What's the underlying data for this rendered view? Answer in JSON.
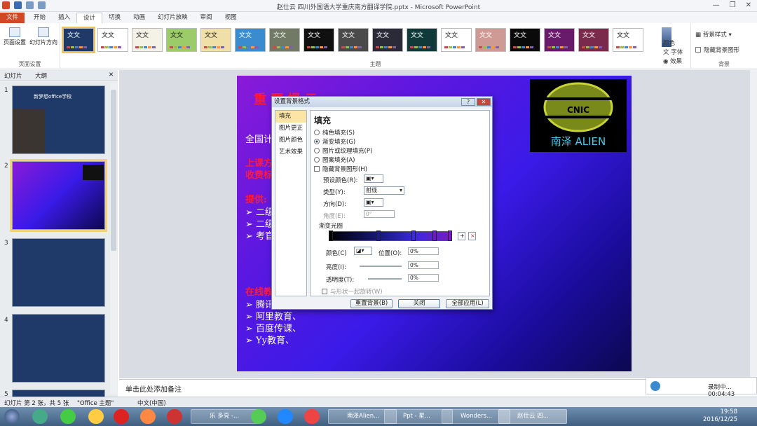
{
  "window": {
    "title": "赵仕云 四川外国语大学重庆南方翻译学院.pptx - Microsoft PowerPoint",
    "min": "—",
    "max": "❐",
    "close": "✕"
  },
  "tabs": [
    "文件",
    "开始",
    "插入",
    "设计",
    "切换",
    "动画",
    "幻灯片放映",
    "审阅",
    "视图"
  ],
  "ribbon": {
    "page_setup": "页面设置",
    "slide_orient": "幻灯片方向",
    "group_page": "页面设置",
    "group_theme": "主题",
    "theme_label": "文文",
    "colors": "颜色",
    "fonts": "字体",
    "effects": "效果",
    "bg_styles": "背景样式",
    "hide_bg": "隐藏背景图形",
    "group_bg": "背景"
  },
  "themes": [
    {
      "bg": "#1f3a68",
      "fg": "#fff",
      "sel": true
    },
    {
      "bg": "#ffffff",
      "fg": "#222"
    },
    {
      "bg": "#f4f1e6",
      "fg": "#222"
    },
    {
      "bg": "#9ccb6a",
      "fg": "#222"
    },
    {
      "bg": "#f1dfa8",
      "fg": "#222"
    },
    {
      "bg": "#3a8ccf",
      "fg": "#fff"
    },
    {
      "bg": "#707a64",
      "fg": "#fff"
    },
    {
      "bg": "#101010",
      "fg": "#fff"
    },
    {
      "bg": "#4a4a4a",
      "fg": "#fff"
    },
    {
      "bg": "#2a2a38",
      "fg": "#fff"
    },
    {
      "bg": "#103a3a",
      "fg": "#fff"
    },
    {
      "bg": "#ffffff",
      "fg": "#222"
    },
    {
      "bg": "#cf9a94",
      "fg": "#fff"
    },
    {
      "bg": "#0a0a0a",
      "fg": "#fff"
    },
    {
      "bg": "#6a1a6a",
      "fg": "#fff"
    },
    {
      "bg": "#7a2a4a",
      "fg": "#fff"
    },
    {
      "bg": "#ffffff",
      "fg": "#222"
    }
  ],
  "pane": {
    "tab_slides": "幻灯片",
    "tab_outline": "大纲",
    "close": "✕"
  },
  "thumbs": [
    {
      "num": "1",
      "title": "新梦想office学校"
    },
    {
      "num": "2",
      "title": ""
    },
    {
      "num": "3",
      "title": ""
    },
    {
      "num": "4",
      "title": ""
    },
    {
      "num": "5",
      "title": ""
    }
  ],
  "slide": {
    "heading": "重 要 提 示",
    "line1": "全国计",
    "line2": "上课方",
    "line3": "收费标",
    "tip": "提供:",
    "b1": "➢  二级",
    "b2": "➢  二级",
    "b3": "➢  考官",
    "online": "在线教",
    "o1": "➢  腾讯",
    "o2": "➢  阿里教育、",
    "o3": "➢  百度传课、",
    "o4": "➢  Yy教育、",
    "logo_text": "CNIC",
    "logo_sub": "南泽 ALIEN"
  },
  "dialog": {
    "title": "设置背景格式",
    "help": "?",
    "close": "✕",
    "cats": [
      "填充",
      "图片更正",
      "图片颜色",
      "艺术效果"
    ],
    "heading": "填充",
    "opts": [
      "纯色填充(S)",
      "渐变填充(G)",
      "图片或纹理填充(P)",
      "图案填充(A)"
    ],
    "hide_bg": "隐藏背景图形(H)",
    "preset": "预设颜色(R):",
    "type": "类型(Y):",
    "type_val": "射线",
    "dir": "方向(D):",
    "angle": "角度(E):",
    "angle_val": "0°",
    "stops": "渐变光圈",
    "color": "颜色(C)",
    "position": "位置(O):",
    "position_val": "0%",
    "brightness": "亮度(I):",
    "brightness_val": "0%",
    "transparency": "透明度(T):",
    "transparency_val": "0%",
    "rotate": "与形状一起旋转(W)",
    "reset": "重置背景(B)",
    "close_btn": "关闭",
    "apply_all": "全部应用(L)"
  },
  "notes": "单击此处添加备注",
  "status": {
    "slide": "幻灯片 第 2 张，共 5 张",
    "theme": "\"Office 主题\"",
    "lang": "中文(中国)"
  },
  "recorder": {
    "label": "录制中... 00:04:43"
  },
  "taskbar": {
    "w1": "乐 多亮 -...",
    "w2": "南泽Alien...",
    "w3": "Ppt - 星...",
    "w4": "Wonders...",
    "w5": "赵仕云 四...",
    "time": "19:58",
    "date": "2016/12/25"
  }
}
